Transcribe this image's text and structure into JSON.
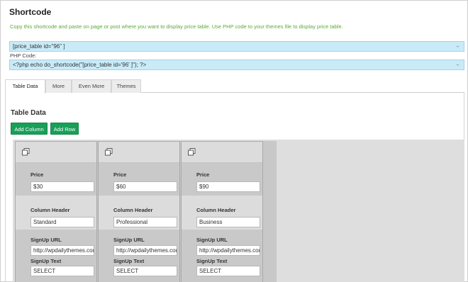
{
  "header": {
    "title": "Shortcode",
    "description": "Copy this shortcode and paste on page or post where you want to display price table. Use PHP code to your themes file to display price table."
  },
  "shortcode": {
    "value": "[price_table  id=\"96\" ]",
    "php_label": "PHP Code:",
    "php_value": "<?php echo do_shortcode(\"[price_table id='96' ]\"); ?>"
  },
  "tabs": [
    {
      "label": "Table Data",
      "active": true
    },
    {
      "label": "More",
      "active": false
    },
    {
      "label": "Even More",
      "active": false
    },
    {
      "label": "Themes",
      "active": false
    }
  ],
  "section": {
    "title": "Table Data",
    "add_column": "Add Column",
    "add_row": "Add Row"
  },
  "labels": {
    "price": "Price",
    "column_header": "Column Header",
    "signup_url": "SignUp URL",
    "signup_text": "SignUp Text"
  },
  "columns": [
    {
      "price": "$30",
      "header": "Standard",
      "url": "http://wpdailythemes.com",
      "text": "SELECT"
    },
    {
      "price": "$60",
      "header": "Professional",
      "url": "http://wpdailythemes.com",
      "text": "SELECT"
    },
    {
      "price": "$90",
      "header": "Business",
      "url": "http://wpdailythemes.com",
      "text": "SELECT"
    }
  ],
  "icons": {
    "copy": "copy-icon",
    "resize_grip": "resize-grip-icon"
  },
  "colors": {
    "accent_green": "#18a058",
    "description_green": "#5aaa3a",
    "code_bg": "#c9ebf8"
  }
}
